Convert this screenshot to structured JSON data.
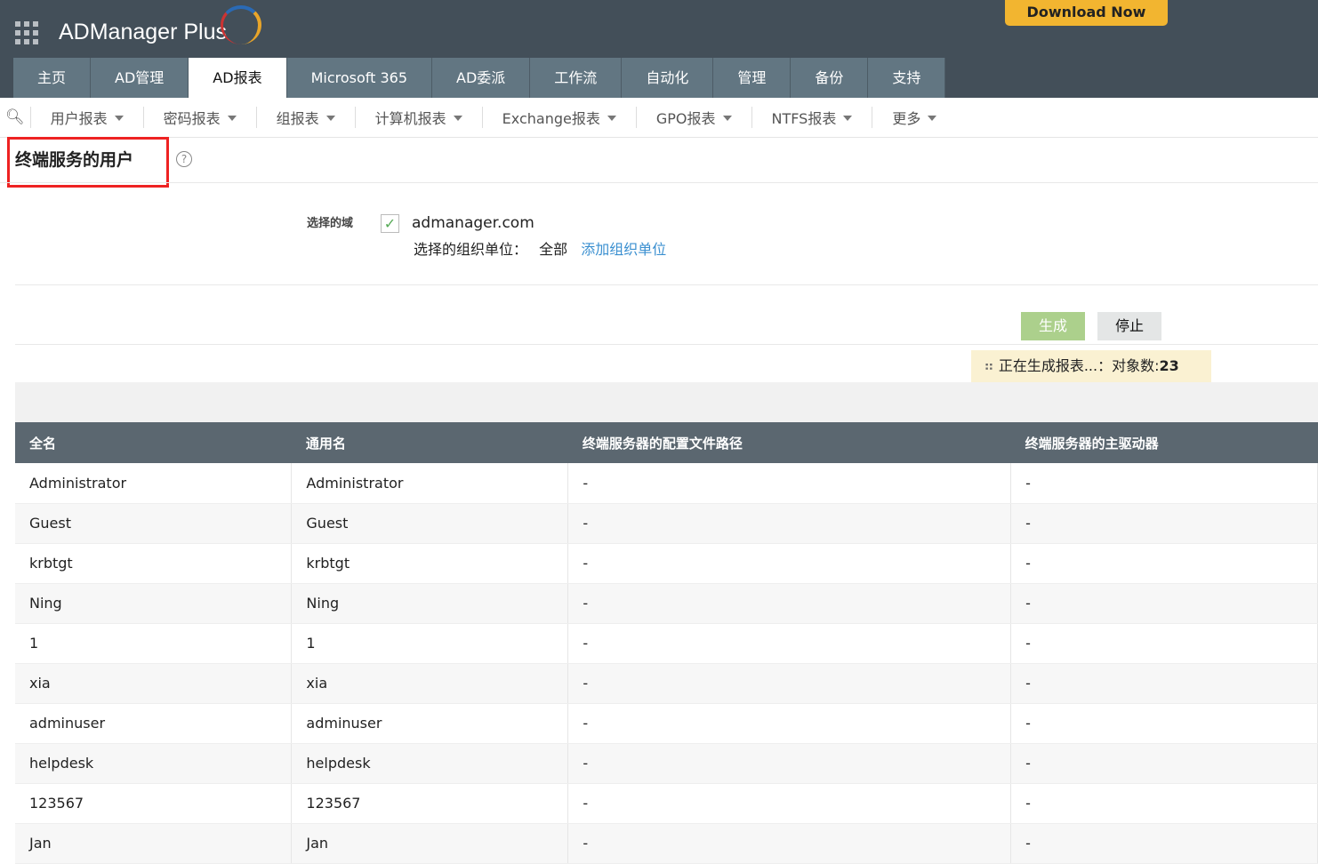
{
  "header": {
    "logo": "ADManager Plus",
    "download": "Download Now",
    "tabs": [
      "主页",
      "AD管理",
      "AD报表",
      "Microsoft 365",
      "AD委派",
      "工作流",
      "自动化",
      "管理",
      "备份",
      "支持"
    ],
    "active_tab": 2
  },
  "subnav": [
    "用户报表",
    "密码报表",
    "组报表",
    "计算机报表",
    "Exchange报表",
    "GPO报表",
    "NTFS报表",
    "更多"
  ],
  "page": {
    "title": "终端服务的用户",
    "help": "?",
    "domain_label": "选择的域",
    "domain": "admanager.com",
    "ou_label": "选择的组织单位：",
    "ou_value": "全部",
    "add_ou": "添加组织单位",
    "generate": "生成",
    "stop": "停止",
    "status": "正在生成报表...：对象数:",
    "count": "23"
  },
  "table": {
    "columns": [
      "全名",
      "通用名",
      "终端服务器的配置文件路径",
      "终端服务器的主驱动器"
    ],
    "rows": [
      [
        "Administrator",
        "Administrator",
        "-",
        "-"
      ],
      [
        "Guest",
        "Guest",
        "-",
        "-"
      ],
      [
        "krbtgt",
        "krbtgt",
        "-",
        "-"
      ],
      [
        "Ning",
        "Ning",
        "-",
        "-"
      ],
      [
        "1",
        "1",
        "-",
        "-"
      ],
      [
        "xia",
        "xia",
        "-",
        "-"
      ],
      [
        "adminuser",
        "adminuser",
        "-",
        "-"
      ],
      [
        "helpdesk",
        "helpdesk",
        "-",
        "-"
      ],
      [
        "123567",
        "123567",
        "-",
        "-"
      ],
      [
        "Jan",
        "Jan",
        "-",
        "-"
      ]
    ]
  }
}
